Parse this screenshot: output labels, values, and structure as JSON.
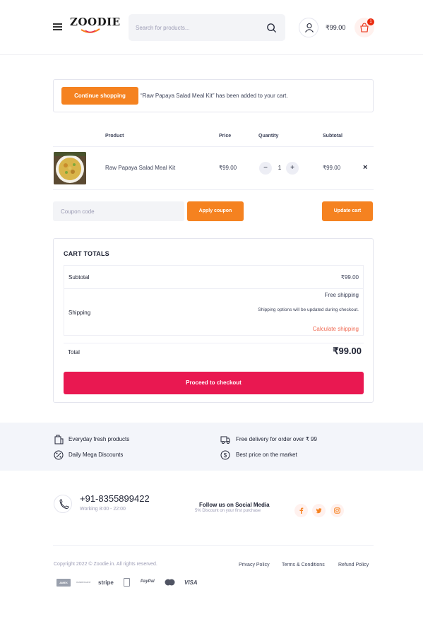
{
  "header": {
    "logo_text": "ZOODIE",
    "search_placeholder": "Search for products...",
    "cart_total": "₹99.00",
    "cart_count": "1"
  },
  "notice": {
    "button_label": "Continue shopping",
    "message": "“Raw Papaya Salad Meal Kit” has been added to your cart."
  },
  "cart_table": {
    "columns": [
      "Product",
      "Price",
      "Quantity",
      "Subtotal"
    ],
    "items": [
      {
        "name": "Raw Papaya Salad Meal Kit",
        "price": "₹99.00",
        "quantity": "1",
        "subtotal": "₹99.00",
        "remove_label": "×"
      }
    ]
  },
  "coupon": {
    "placeholder": "Coupon code",
    "apply_label": "Apply coupon",
    "update_label": "Update cart"
  },
  "totals": {
    "title": "CART TOTALS",
    "subtotal_label": "Subtotal",
    "subtotal_value": "₹99.00",
    "shipping_label": "Shipping",
    "shipping_method": "Free shipping",
    "shipping_note": "Shipping options will be updated during checkout.",
    "calculate_link": "Calculate shipping",
    "total_label": "Total",
    "total_value": "₹99.00",
    "checkout_label": "Proceed to checkout"
  },
  "features": [
    {
      "icon": "fresh-products-icon",
      "label": "Everyday fresh products"
    },
    {
      "icon": "delivery-truck-icon",
      "label": "Free delivery for order over ₹ 99"
    },
    {
      "icon": "discount-icon",
      "label": "Daily Mega Discounts"
    },
    {
      "icon": "best-price-icon",
      "label": "Best price on the market"
    }
  ],
  "contact": {
    "phone": "+91-8355899422",
    "hours": "Working 8:00 - 22:00",
    "follow_title": "Follow us on Social Media",
    "follow_sub": "5% Discount on your first purchase"
  },
  "social": [
    "facebook-icon",
    "twitter-icon",
    "instagram-icon"
  ],
  "footer": {
    "copyright": "Copyright 2022 © Zoodie.in. All rights reserved.",
    "links": [
      "Privacy Policy",
      "Terms & Conditions",
      "Refund Policy"
    ],
    "payments": [
      "AMEX",
      "mastercard",
      "stripe",
      "PayPal",
      "VISA"
    ]
  },
  "colors": {
    "accent_orange": "#f58220",
    "checkout_red": "#e91851",
    "link_coral": "#f06b54",
    "features_bg": "#f3f5fa"
  }
}
